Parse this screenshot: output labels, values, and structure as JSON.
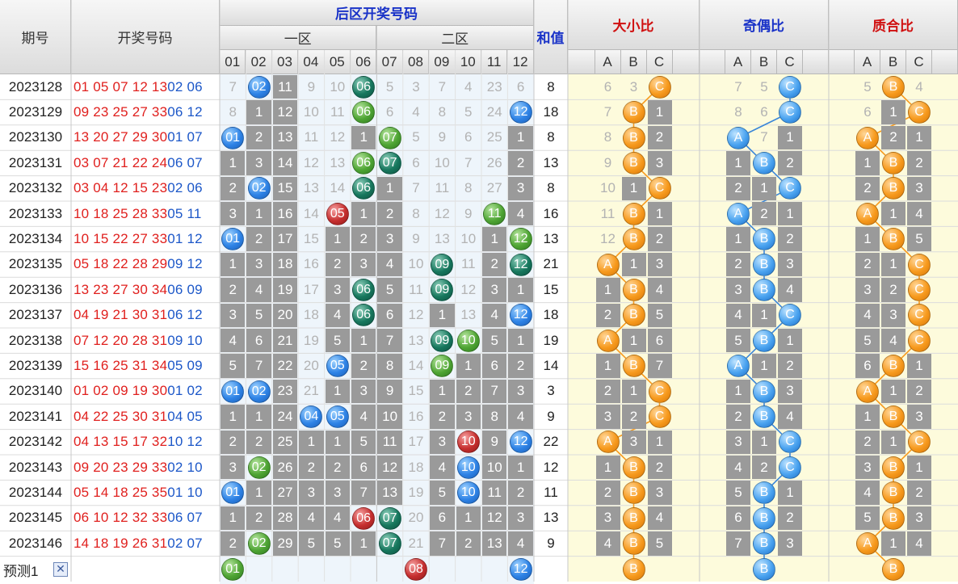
{
  "colors": {
    "front_red": "#e0201e",
    "back_blue": "#1c57c8",
    "ratio_bg": "#fdfbdc",
    "back_bg": "#eef5fb",
    "gray_cell": "#9a9a9a",
    "header_blue": "#1a33c8",
    "header_red": "#d01010"
  },
  "header": {
    "issue": "期号",
    "draw": "开奖号码",
    "back_zone": "后区开奖号码",
    "zone1": "一区",
    "zone2": "二区",
    "sum": "和值",
    "size_ratio": "大小比",
    "odd_even_ratio": "奇偶比",
    "prime_ratio": "质合比",
    "abc": [
      "A",
      "B",
      "C"
    ],
    "numbers": [
      "01",
      "02",
      "03",
      "04",
      "05",
      "06",
      "07",
      "08",
      "09",
      "10",
      "11",
      "12"
    ]
  },
  "rows": [
    {
      "issue": "2023128",
      "front": "01 05 07 12 13",
      "back": "02 06",
      "n": [
        7,
        "B02",
        11,
        9,
        10,
        "T06",
        5,
        3,
        7,
        4,
        23,
        6
      ],
      "sum": "8",
      "s": [
        6,
        3,
        "C"
      ],
      "oe": [
        7,
        5,
        "C"
      ],
      "pc": [
        5,
        "B",
        4
      ]
    },
    {
      "issue": "2023129",
      "front": "09 23 25 27 33",
      "back": "06 12",
      "n": [
        8,
        1,
        12,
        10,
        11,
        "G06",
        6,
        4,
        8,
        5,
        24,
        "B12"
      ],
      "sum": "18",
      "s": [
        7,
        "B",
        1
      ],
      "oe": [
        8,
        6,
        "C"
      ],
      "pc": [
        6,
        1,
        "C"
      ]
    },
    {
      "issue": "2023130",
      "front": "13 20 27 29 30",
      "back": "01 07",
      "n": [
        "B01",
        2,
        13,
        11,
        12,
        1,
        "G07",
        5,
        9,
        6,
        25,
        1
      ],
      "sum": "8",
      "s": [
        8,
        "B",
        2
      ],
      "oe": [
        "A",
        7,
        1
      ],
      "pc": [
        "A",
        2,
        1
      ]
    },
    {
      "issue": "2023131",
      "front": "03 07 21 22 24",
      "back": "06 07",
      "n": [
        1,
        3,
        14,
        12,
        13,
        "G06",
        "T07",
        6,
        10,
        7,
        26,
        2
      ],
      "sum": "13",
      "s": [
        9,
        "B",
        3
      ],
      "oe": [
        1,
        "B",
        2
      ],
      "pc": [
        1,
        "B",
        2
      ]
    },
    {
      "issue": "2023132",
      "front": "03 04 12 15 23",
      "back": "02 06",
      "n": [
        2,
        "B02",
        15,
        13,
        14,
        "T06",
        1,
        7,
        11,
        8,
        27,
        3
      ],
      "sum": "8",
      "s": [
        10,
        1,
        "C"
      ],
      "oe": [
        2,
        1,
        "C"
      ],
      "pc": [
        2,
        "B",
        3
      ]
    },
    {
      "issue": "2023133",
      "front": "10 18 25 28 33",
      "back": "05 11",
      "n": [
        3,
        1,
        16,
        14,
        "R05",
        1,
        2,
        8,
        12,
        9,
        "G11",
        4
      ],
      "sum": "16",
      "s": [
        11,
        "B",
        1
      ],
      "oe": [
        "A",
        2,
        1
      ],
      "pc": [
        "A",
        1,
        4
      ]
    },
    {
      "issue": "2023134",
      "front": "10 15 22 27 33",
      "back": "01 12",
      "n": [
        "B01",
        2,
        17,
        15,
        1,
        2,
        3,
        9,
        13,
        10,
        1,
        "G12"
      ],
      "sum": "13",
      "s": [
        12,
        "B",
        2
      ],
      "oe": [
        1,
        "B",
        2
      ],
      "pc": [
        1,
        "B",
        5
      ]
    },
    {
      "issue": "2023135",
      "front": "05 18 22 28 29",
      "back": "09 12",
      "n": [
        1,
        3,
        18,
        16,
        2,
        3,
        4,
        10,
        "T09",
        11,
        2,
        "T12"
      ],
      "sum": "21",
      "s": [
        "A",
        1,
        3
      ],
      "oe": [
        2,
        "B",
        3
      ],
      "pc": [
        2,
        1,
        "C"
      ]
    },
    {
      "issue": "2023136",
      "front": "13 23 27 30 34",
      "back": "06 09",
      "n": [
        2,
        4,
        19,
        17,
        3,
        "T06",
        5,
        11,
        "T09",
        12,
        3,
        1
      ],
      "sum": "15",
      "s": [
        1,
        "B",
        4
      ],
      "oe": [
        3,
        "B",
        4
      ],
      "pc": [
        3,
        2,
        "C"
      ]
    },
    {
      "issue": "2023137",
      "front": "04 19 21 30 31",
      "back": "06 12",
      "n": [
        3,
        5,
        20,
        18,
        4,
        "T06",
        6,
        12,
        1,
        13,
        4,
        "B12"
      ],
      "sum": "18",
      "s": [
        2,
        "B",
        5
      ],
      "oe": [
        4,
        1,
        "C"
      ],
      "pc": [
        4,
        3,
        "C"
      ]
    },
    {
      "issue": "2023138",
      "front": "07 12 20 28 31",
      "back": "09 10",
      "n": [
        4,
        6,
        21,
        19,
        5,
        1,
        7,
        13,
        "T09",
        "G10",
        5,
        1
      ],
      "sum": "19",
      "s": [
        "A",
        1,
        6
      ],
      "oe": [
        5,
        "B",
        1
      ],
      "pc": [
        5,
        4,
        "C"
      ]
    },
    {
      "issue": "2023139",
      "front": "15 16 25 31 34",
      "back": "05 09",
      "n": [
        5,
        7,
        22,
        20,
        "B05",
        2,
        8,
        14,
        "G09",
        1,
        6,
        2
      ],
      "sum": "14",
      "s": [
        1,
        "B",
        7
      ],
      "oe": [
        "A",
        1,
        2
      ],
      "pc": [
        6,
        "B",
        1
      ]
    },
    {
      "issue": "2023140",
      "front": "01 02 09 19 30",
      "back": "01 02",
      "n": [
        "B01",
        "B02",
        23,
        21,
        1,
        3,
        9,
        15,
        1,
        2,
        7,
        3
      ],
      "sum": "3",
      "s": [
        2,
        1,
        "C"
      ],
      "oe": [
        1,
        "B",
        3
      ],
      "pc": [
        "A",
        1,
        2
      ]
    },
    {
      "issue": "2023141",
      "front": "04 22 25 30 31",
      "back": "04 05",
      "n": [
        1,
        1,
        24,
        "B04",
        "B05",
        4,
        10,
        16,
        2,
        3,
        8,
        4
      ],
      "sum": "9",
      "s": [
        3,
        2,
        "C"
      ],
      "oe": [
        2,
        "B",
        4
      ],
      "pc": [
        1,
        "B",
        3
      ]
    },
    {
      "issue": "2023142",
      "front": "04 13 15 17 32",
      "back": "10 12",
      "n": [
        2,
        2,
        25,
        1,
        1,
        5,
        11,
        17,
        3,
        "R10",
        9,
        "B12"
      ],
      "sum": "22",
      "s": [
        "A",
        3,
        1
      ],
      "oe": [
        3,
        1,
        "C"
      ],
      "pc": [
        2,
        1,
        "C"
      ]
    },
    {
      "issue": "2023143",
      "front": "09 20 23 29 33",
      "back": "02 10",
      "n": [
        3,
        "G02",
        26,
        2,
        2,
        6,
        12,
        18,
        4,
        "B10",
        10,
        1
      ],
      "sum": "12",
      "s": [
        1,
        "B",
        2
      ],
      "oe": [
        4,
        2,
        "C"
      ],
      "pc": [
        3,
        "B",
        1
      ]
    },
    {
      "issue": "2023144",
      "front": "05 14 18 25 35",
      "back": "01 10",
      "n": [
        "B01",
        1,
        27,
        3,
        3,
        7,
        13,
        19,
        5,
        "B10",
        11,
        2
      ],
      "sum": "11",
      "s": [
        2,
        "B",
        3
      ],
      "oe": [
        5,
        "B",
        1
      ],
      "pc": [
        4,
        "B",
        2
      ]
    },
    {
      "issue": "2023145",
      "front": "06 10 12 32 33",
      "back": "06 07",
      "n": [
        1,
        2,
        28,
        4,
        4,
        "R06",
        "T07",
        20,
        6,
        1,
        12,
        3
      ],
      "sum": "13",
      "s": [
        3,
        "B",
        4
      ],
      "oe": [
        6,
        "B",
        2
      ],
      "pc": [
        5,
        "B",
        3
      ]
    },
    {
      "issue": "2023146",
      "front": "14 18 19 26 31",
      "back": "02 07",
      "n": [
        2,
        "G02",
        29,
        5,
        5,
        1,
        "T07",
        21,
        7,
        2,
        13,
        4
      ],
      "sum": "9",
      "s": [
        4,
        "B",
        5
      ],
      "oe": [
        7,
        "B",
        3
      ],
      "pc": [
        "A",
        1,
        4
      ]
    }
  ],
  "prediction": {
    "label": "预测1",
    "close": "✕",
    "n": [
      "G01",
      null,
      null,
      null,
      null,
      null,
      null,
      "R08",
      null,
      null,
      null,
      "B12"
    ],
    "s": [
      null,
      "B",
      null
    ],
    "oe": [
      null,
      "B",
      null
    ],
    "pc": [
      null,
      "B",
      null
    ]
  }
}
